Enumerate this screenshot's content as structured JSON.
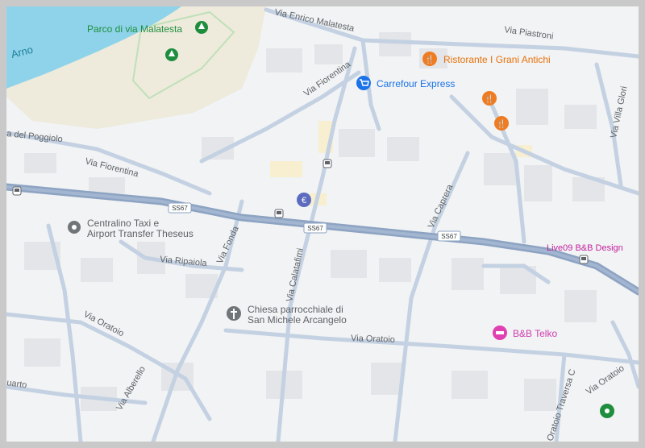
{
  "map": {
    "water_label": "Arno",
    "park_label": "Parco di via Malatesta",
    "streets": {
      "via_enrico_malatesta": "Via Enrico Malatesta",
      "via_piastroni": "Via Piastroni",
      "via_fiorentina_north": "Via Fiorentina",
      "via_fiorentina_west": "Via Fiorentina",
      "via_del_poggiolo": "a del Poggiolo",
      "via_caprera": "Via Caprera",
      "via_villa_glori": "Via Villa Glori",
      "via_fonda": "Via Fonda",
      "via_ripaiola": "Via Ripaiola",
      "via_calatafimi": "Via Calatafimi",
      "via_oratoio_west": "Via Oratoio",
      "via_oratoio_center": "Via Oratoio",
      "via_oratoio_east": "Via Oratoio",
      "via_alberello": "Via Alberello",
      "uarto": "uarto",
      "oratoio_traversa": "Oratoio Traversa C"
    },
    "road_shields": [
      "SS67",
      "SS67",
      "SS67"
    ],
    "pois": [
      {
        "name": "Ristorante I Grani Antichi",
        "icon": "restaurant-icon",
        "color": "#f07c21"
      },
      {
        "name": "Carrefour Express",
        "icon": "shopping-cart-icon",
        "color": "#1a73e8"
      },
      {
        "name": "Centralino Taxi e",
        "name2": "Airport Transfer Theseus",
        "icon": "poi-dot-icon",
        "color": "#70757a"
      },
      {
        "name": "Chiesa parrocchiale di",
        "name2": "San Michele Arcangelo",
        "icon": "church-icon",
        "color": "#70757a"
      },
      {
        "name": "Live09 B&B Design",
        "icon": "hotel-icon",
        "color": "#d13baf"
      },
      {
        "name": "B&B Telko",
        "icon": "bed-icon",
        "color": "#e040b0"
      }
    ],
    "colors": {
      "background": "#f1f3f4",
      "road": "#c4d1e2",
      "highway": "#8da3c2",
      "water": "#8ed3e9",
      "park": "#eeeadc",
      "building": "#e2e4e7",
      "restaurant": "#f07c21",
      "shop": "#1a73e8",
      "lodging": "#e040b0",
      "park_pin": "#1e8e3e"
    }
  }
}
